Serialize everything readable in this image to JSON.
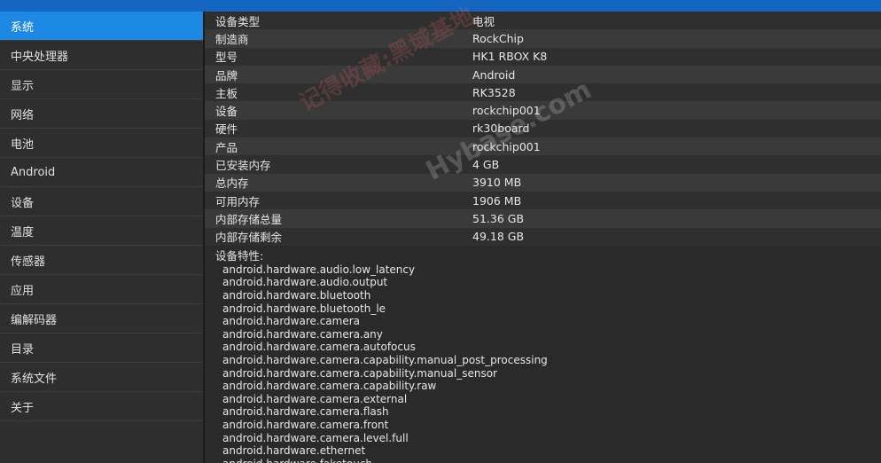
{
  "sidebar": {
    "items": [
      {
        "label": "系统",
        "selected": true
      },
      {
        "label": "中央处理器"
      },
      {
        "label": "显示"
      },
      {
        "label": "网络"
      },
      {
        "label": "电池"
      },
      {
        "label": "Android"
      },
      {
        "label": "设备"
      },
      {
        "label": "温度"
      },
      {
        "label": "传感器"
      },
      {
        "label": "应用"
      },
      {
        "label": "编解码器"
      },
      {
        "label": "目录"
      },
      {
        "label": "系统文件"
      },
      {
        "label": "关于"
      }
    ]
  },
  "info_rows": [
    {
      "key": "设备类型",
      "value": "电视"
    },
    {
      "key": "制造商",
      "value": "RockChip"
    },
    {
      "key": "型号",
      "value": "HK1 RBOX K8"
    },
    {
      "key": "品牌",
      "value": "Android"
    },
    {
      "key": "主板",
      "value": "RK3528"
    },
    {
      "key": "设备",
      "value": "rockchip001"
    },
    {
      "key": "硬件",
      "value": "rk30board"
    },
    {
      "key": "产品",
      "value": "rockchip001"
    },
    {
      "key": "已安装内存",
      "value": "4 GB"
    },
    {
      "key": "总内存",
      "value": "3910 MB"
    },
    {
      "key": "可用内存",
      "value": "1906 MB"
    },
    {
      "key": "内部存储总量",
      "value": "51.36 GB"
    },
    {
      "key": "内部存储剩余",
      "value": "49.18 GB"
    }
  ],
  "features": {
    "title": "设备特性:",
    "items": [
      "android.hardware.audio.low_latency",
      "android.hardware.audio.output",
      "android.hardware.bluetooth",
      "android.hardware.bluetooth_le",
      "android.hardware.camera",
      "android.hardware.camera.any",
      "android.hardware.camera.autofocus",
      "android.hardware.camera.capability.manual_post_processing",
      "android.hardware.camera.capability.manual_sensor",
      "android.hardware.camera.capability.raw",
      "android.hardware.camera.external",
      "android.hardware.camera.flash",
      "android.hardware.camera.front",
      "android.hardware.camera.level.full",
      "android.hardware.ethernet",
      "android.hardware.faketouch"
    ]
  },
  "watermark": {
    "line1": "记得收藏:黑域基地",
    "line2": "Hybase.com"
  },
  "colors": {
    "accent": "#1e88e5",
    "topbar": "#1565c0"
  }
}
